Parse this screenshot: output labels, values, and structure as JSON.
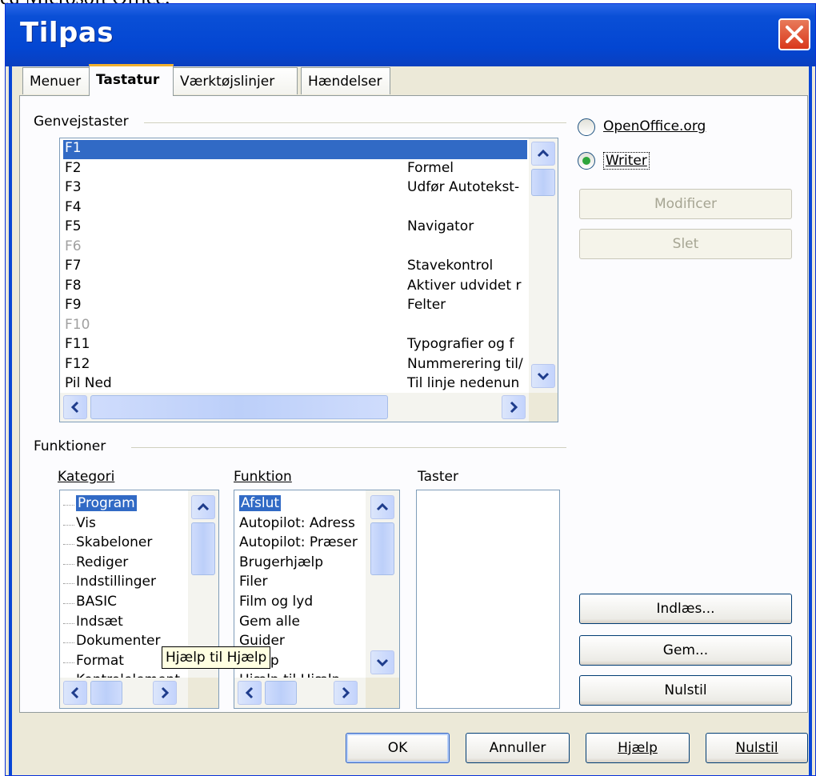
{
  "background_caption": "ed Microsoft Office.",
  "window": {
    "title": "Tilpas"
  },
  "tabs": [
    {
      "label": "Menuer"
    },
    {
      "label": "Tastatur"
    },
    {
      "label": "Værktøjslinjer"
    },
    {
      "label": "Hændelser"
    }
  ],
  "active_tab": "Tastatur",
  "shortcuts": {
    "group_label": "Genvejstaster",
    "rows": [
      {
        "key": "F1",
        "function": "",
        "state": "selected"
      },
      {
        "key": "F2",
        "function": "Formel",
        "state": "normal"
      },
      {
        "key": "F3",
        "function": "Udfør Autotekst-",
        "state": "normal"
      },
      {
        "key": "F4",
        "function": "",
        "state": "normal"
      },
      {
        "key": "F5",
        "function": "Navigator",
        "state": "normal"
      },
      {
        "key": "F6",
        "function": "",
        "state": "disabled"
      },
      {
        "key": "F7",
        "function": "Stavekontrol",
        "state": "normal"
      },
      {
        "key": "F8",
        "function": "Aktiver udvidet r",
        "state": "normal"
      },
      {
        "key": "F9",
        "function": "Felter",
        "state": "normal"
      },
      {
        "key": "F10",
        "function": "",
        "state": "disabled"
      },
      {
        "key": "F11",
        "function": "Typografier og f",
        "state": "normal"
      },
      {
        "key": "F12",
        "function": "Nummerering til/",
        "state": "normal"
      },
      {
        "key": "Pil Ned",
        "function": "Til linje nedenun",
        "state": "normal"
      }
    ]
  },
  "scope": {
    "openoffice_label": "OpenOffice.org",
    "writer_label": "Writer",
    "selected": "Writer"
  },
  "buttons": {
    "modify": "Modificer",
    "delete": "Slet",
    "load": "Indlæs...",
    "save": "Gem...",
    "reset": "Nulstil"
  },
  "functions": {
    "group_label": "Funktioner",
    "category_label": "Kategori",
    "function_label": "Funktion",
    "keys_label": "Taster",
    "categories": [
      "Program",
      "Vis",
      "Skabeloner",
      "Rediger",
      "Indstillinger",
      "BASIC",
      "Indsæt",
      "Dokumenter",
      "Format",
      "Kontrolelement"
    ],
    "selected_category": "Program",
    "functions": [
      "Afslut",
      "Autopilot: Adress",
      "Autopilot: Præser",
      "Brugerhjælp",
      "Filer",
      "Film og lyd",
      "Gem alle",
      "Guider",
      "Hjælp",
      "Hjælp til Hjælp"
    ],
    "selected_function": "Afslut",
    "keys": []
  },
  "tooltip": "Hjælp til Hjælp",
  "footer": {
    "ok": "OK",
    "cancel": "Annuller",
    "help": "Hjælp",
    "reset": "Nulstil"
  }
}
